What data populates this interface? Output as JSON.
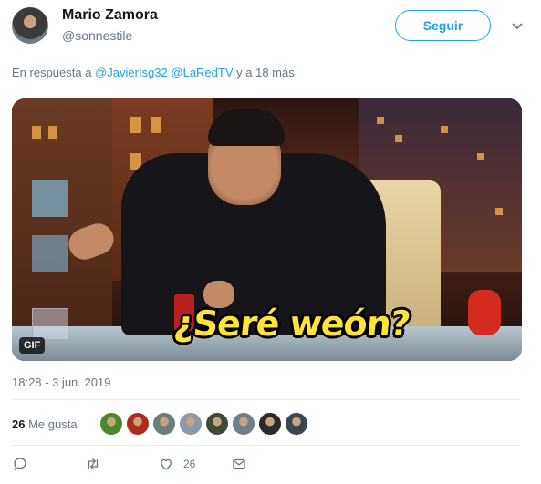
{
  "author": {
    "display_name": "Mario Zamora",
    "handle": "@sonnestile"
  },
  "follow_button_label": "Seguir",
  "reply": {
    "prefix": "En respuesta a",
    "mention_1": "@JavierIsg32",
    "mention_2": "@LaRedTV",
    "suffix": "y a 18 más"
  },
  "media": {
    "badge": "GIF",
    "caption": "¿Seré weón?"
  },
  "timestamp": "18:28 - 3 jun. 2019",
  "likes": {
    "count": "26",
    "label": "Me gusta",
    "avatar_colors": [
      "#4a8a2a",
      "#b02a20",
      "#6b7f7a",
      "#8a9aa8",
      "#3e4a3a",
      "#707f8a",
      "#2a2a2a",
      "#3a4652"
    ]
  },
  "actions": {
    "reply_icon": "reply-icon",
    "retweet_icon": "retweet-icon",
    "like_icon": "heart-icon",
    "like_count": "26",
    "dm_icon": "envelope-icon"
  },
  "colors": {
    "accent": "#1da1f2",
    "muted": "#657786",
    "caption": "#ffe33a"
  }
}
